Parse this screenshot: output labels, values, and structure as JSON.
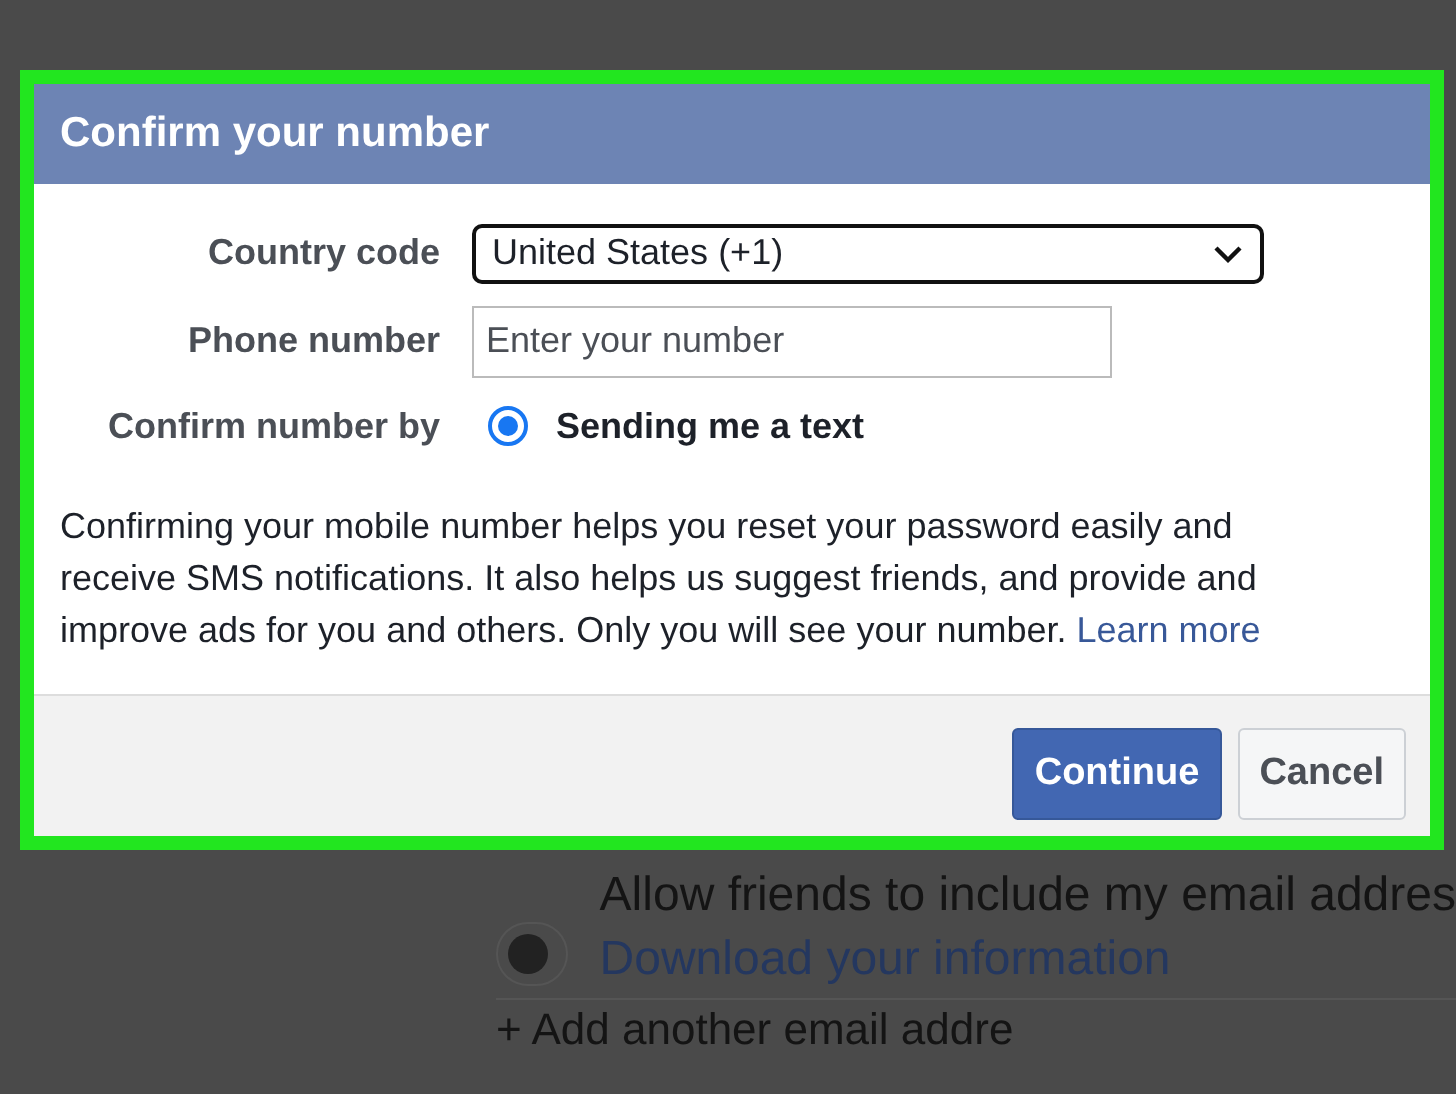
{
  "dialog": {
    "title": "Confirm your number",
    "country_code": {
      "label": "Country code",
      "value": "United States (+1)"
    },
    "phone_number": {
      "label": "Phone number",
      "placeholder": "Enter your number"
    },
    "confirm_by": {
      "label": "Confirm number by",
      "option": {
        "label": "Sending me a text",
        "selected": true
      }
    },
    "description": {
      "text": "Confirming your mobile number helps you reset your password easily and receive SMS notifications. It also helps us suggest friends, and provide and improve ads for you and others. Only you will see your number.",
      "link": "Learn more"
    },
    "buttons": [
      {
        "label": "Continue",
        "kind": "primary"
      },
      {
        "label": "Cancel",
        "kind": "secondary"
      }
    ]
  },
  "background": {
    "toggle": {
      "on": false
    },
    "setting_text": "Allow friends to include my email addres",
    "download_link": "Download your information",
    "add_email_link": "+ Add another email addre"
  }
}
